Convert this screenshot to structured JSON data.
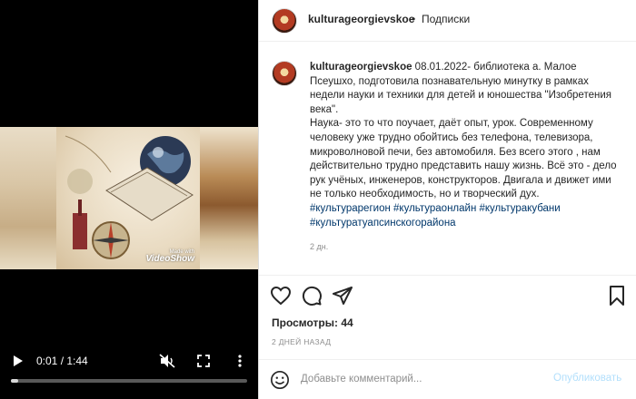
{
  "video": {
    "watermark_line1": "Made with",
    "watermark_line2": "VideoShow",
    "time": "0:01 / 1:44",
    "progress_fraction": 0.01
  },
  "header": {
    "username": "kulturageorgievskoe",
    "separator": "•",
    "follow_label": "Подписки"
  },
  "caption": {
    "username": "kulturageorgievskoe",
    "text_line1": " 08.01.2022- библиотека а. Малое Псеушхо, подготовила познавательную минутку в рамках недели науки и техники для детей и юношества \"Изобретения века\".",
    "text_line2": "Наука- это то что поучает, даёт опыт, урок. Современному человеку уже трудно обойтись без телефона, телевизора, микроволновой печи, без автомобиля. Без всего этого , нам действительно трудно представить нашу жизнь. Всё это - дело рук учёных, инженеров, конструкторов. Двигала и движет ими не только необходимость, но и творческий дух.",
    "tags_line1": "#культурарегион #культураонлайн #культуракубани",
    "tags_line2": "#культуратуапсинскогорайона",
    "ago": "2 дн."
  },
  "actions": {
    "views_label": "Просмотры: 44",
    "timestamp": "2 ДНЕЙ НАЗАД"
  },
  "comment_box": {
    "placeholder": "Добавьте комментарий...",
    "publish_label": "Опубликовать"
  },
  "icons": {
    "play": "play-icon",
    "mute": "mute-icon",
    "fullscreen": "fullscreen-icon",
    "more": "more-vertical-icon",
    "like": "heart-icon",
    "comment": "comment-icon",
    "share": "send-icon",
    "save": "bookmark-icon",
    "emoji": "emoji-icon"
  },
  "colors": {
    "link": "#00376b",
    "publish_disabled": "#b2dffc",
    "muted": "#8e8e8e"
  }
}
